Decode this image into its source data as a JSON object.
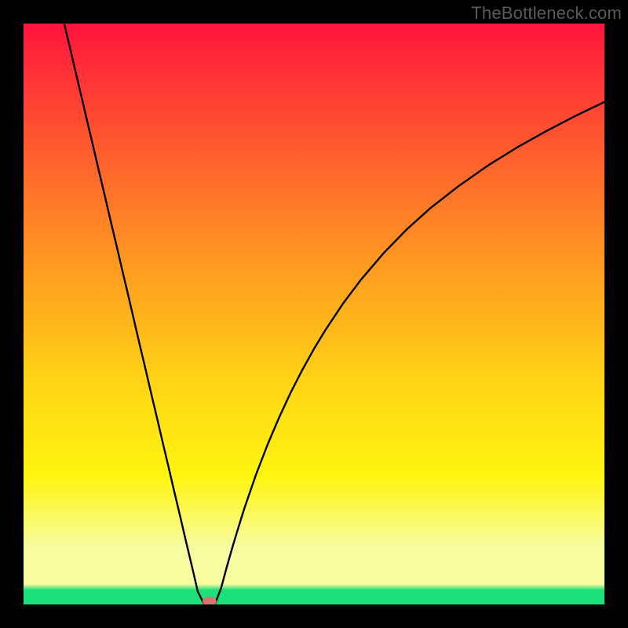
{
  "watermark": "TheBottleneck.com",
  "colors": {
    "frame": "#000000",
    "curve": "#000000",
    "marker": "#d9736f",
    "bg_top": "#ff143c",
    "bg_mid1": "#ff5030",
    "bg_mid2": "#ff9522",
    "bg_mid3": "#ffd515",
    "bg_mid4": "#fff510",
    "bg_pale": "#f7fca0",
    "bg_green": "#1ce079"
  },
  "chart_data": {
    "type": "line",
    "title": "",
    "xlabel": "",
    "ylabel": "",
    "xlim": [
      0,
      100
    ],
    "ylim": [
      0,
      100
    ],
    "x": [
      7,
      8,
      9,
      10,
      11,
      12,
      13,
      14,
      15,
      16,
      17,
      18,
      19,
      20,
      21,
      22,
      23,
      24,
      25,
      26,
      27,
      28,
      29,
      30,
      31,
      32,
      33,
      34,
      35,
      36,
      37,
      38,
      40,
      42,
      44,
      46,
      48,
      50,
      52,
      55,
      58,
      62,
      66,
      70,
      75,
      80,
      85,
      90,
      95,
      100
    ],
    "values": [
      100,
      95.8,
      91.5,
      87.3,
      83.0,
      78.8,
      74.5,
      70.3,
      66.0,
      61.8,
      57.5,
      53.3,
      49.0,
      44.7,
      40.5,
      36.2,
      32.0,
      27.7,
      23.5,
      19.2,
      15.0,
      10.7,
      6.5,
      2.2,
      0.2,
      0.0,
      0.2,
      2.8,
      6.5,
      10.0,
      13.3,
      16.5,
      22.3,
      27.5,
      32.2,
      36.5,
      40.4,
      44.0,
      47.3,
      51.8,
      55.8,
      60.5,
      64.6,
      68.2,
      72.1,
      75.6,
      78.7,
      81.5,
      84.1,
      86.5
    ],
    "marker": {
      "x": 32,
      "y": 0
    }
  }
}
